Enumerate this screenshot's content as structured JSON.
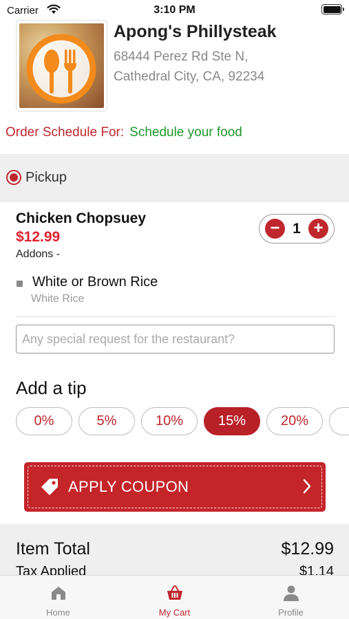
{
  "status_bar": {
    "carrier": "Carrier",
    "time": "3:10 PM"
  },
  "restaurant": {
    "name": "Apong's Phillysteak",
    "address_line1": "68444 Perez Rd Ste N,",
    "address_line2": "Cathedral City, CA, 92234"
  },
  "schedule": {
    "label": "Order Schedule For:",
    "value": "Schedule your food"
  },
  "order_type": {
    "label": "Pickup",
    "selected": true
  },
  "cart_item": {
    "name": "Chicken Chopsuey",
    "price": "$12.99",
    "addons_label": "Addons -",
    "quantity": "1",
    "minus": "−",
    "plus": "+",
    "addon_group": "White or Brown Rice",
    "addon_choice": "White Rice"
  },
  "special_request": {
    "placeholder": "Any special request for the restaurant?",
    "value": ""
  },
  "tip": {
    "title": "Add a tip",
    "options": [
      "0%",
      "5%",
      "10%",
      "15%",
      "20%",
      ""
    ],
    "selected": "15%"
  },
  "coupon": {
    "label": "APPLY COUPON"
  },
  "totals": {
    "item_total_label": "Item Total",
    "item_total_value": "$12.99",
    "tax_label": "Tax Applied",
    "tax_value": "$1.14"
  },
  "tab_bar": {
    "tabs": [
      {
        "label": "Home",
        "icon": "home-icon"
      },
      {
        "label": "My Cart",
        "icon": "basket-icon"
      },
      {
        "label": "Profile",
        "icon": "profile-icon"
      }
    ],
    "active": "My Cart"
  },
  "colors": {
    "accent": "#c0272d",
    "price": "#e0202e",
    "schedule_value": "#1d9a2a",
    "band": "#efefef"
  }
}
